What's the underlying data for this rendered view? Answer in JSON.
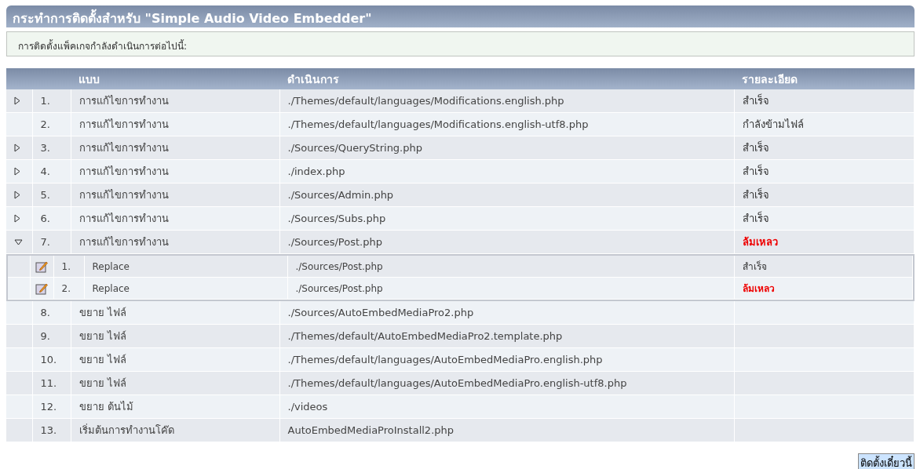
{
  "title": "กระทำการติดตั้งสำหรับ \"Simple Audio Video Embedder\"",
  "notice": "การติดตั้งแพ็คเกจกำลังดำเนินการต่อไปนี้:",
  "table": {
    "columns": [
      "แบบ",
      "ดำเนินการ",
      "รายละเอียด"
    ],
    "rows": [
      {
        "number": "1.",
        "type": "การแก้ไขการทำงาน",
        "action": "./Themes/default/languages/Modifications.english.php",
        "detail": "สำเร็จ",
        "failed": false,
        "kind": "expandable",
        "expanded": false
      },
      {
        "number": "2.",
        "type": "การแก้ไขการทำงาน",
        "action": "./Themes/default/languages/Modifications.english-utf8.php",
        "detail": "กำลังข้ามไฟล์",
        "failed": false,
        "kind": "plain"
      },
      {
        "number": "3.",
        "type": "การแก้ไขการทำงาน",
        "action": "./Sources/QueryString.php",
        "detail": "สำเร็จ",
        "failed": false,
        "kind": "expandable",
        "expanded": false
      },
      {
        "number": "4.",
        "type": "การแก้ไขการทำงาน",
        "action": "./index.php",
        "detail": "สำเร็จ",
        "failed": false,
        "kind": "expandable",
        "expanded": false
      },
      {
        "number": "5.",
        "type": "การแก้ไขการทำงาน",
        "action": "./Sources/Admin.php",
        "detail": "สำเร็จ",
        "failed": false,
        "kind": "expandable",
        "expanded": false
      },
      {
        "number": "6.",
        "type": "การแก้ไขการทำงาน",
        "action": "./Sources/Subs.php",
        "detail": "สำเร็จ",
        "failed": false,
        "kind": "expandable",
        "expanded": false
      },
      {
        "number": "7.",
        "type": "การแก้ไขการทำงาน",
        "action": "./Sources/Post.php",
        "detail": "ล้มเหลว",
        "failed": true,
        "kind": "expandable",
        "expanded": true,
        "children": [
          {
            "number": "1.",
            "type": "Replace",
            "action": "./Sources/Post.php",
            "detail": "สำเร็จ",
            "failed": false
          },
          {
            "number": "2.",
            "type": "Replace",
            "action": "./Sources/Post.php",
            "detail": "ล้มเหลว",
            "failed": true
          }
        ]
      },
      {
        "number": "8.",
        "type": "ขยาย ไฟล์",
        "action": "./Sources/AutoEmbedMediaPro2.php",
        "kind": "plain"
      },
      {
        "number": "9.",
        "type": "ขยาย ไฟล์",
        "action": "./Themes/default/AutoEmbedMediaPro2.template.php",
        "kind": "plain"
      },
      {
        "number": "10.",
        "type": "ขยาย ไฟล์",
        "action": "./Themes/default/languages/AutoEmbedMediaPro.english.php",
        "kind": "plain"
      },
      {
        "number": "11.",
        "type": "ขยาย ไฟล์",
        "action": "./Themes/default/languages/AutoEmbedMediaPro.english-utf8.php",
        "kind": "plain"
      },
      {
        "number": "12.",
        "type": "ขยาย ต้นไม้",
        "action": "./videos",
        "kind": "plain"
      },
      {
        "number": "13.",
        "type": "เริ่มต้นการทำงานโค๊ด",
        "action": "AutoEmbedMediaProInstall2.php",
        "kind": "plain"
      }
    ]
  },
  "button": "ติดตั้งเดี๋ยวนี้"
}
